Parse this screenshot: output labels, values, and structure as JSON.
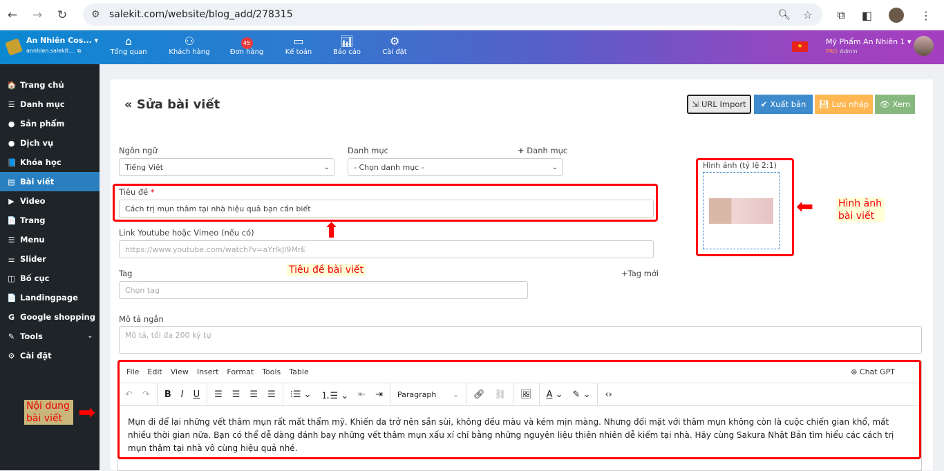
{
  "browser": {
    "url": "salekit.com/website/blog_add/278315"
  },
  "topnav": {
    "brand_name": "An Nhiên Cos...",
    "brand_domain": "annhien.salekit....",
    "items": [
      {
        "label": "Tổng quan",
        "icon": "home-icon"
      },
      {
        "label": "Khách hàng",
        "icon": "users-icon"
      },
      {
        "label": "Đơn hàng",
        "icon": "orders-icon",
        "badge": "45"
      },
      {
        "label": "Kế toán",
        "icon": "card-icon"
      },
      {
        "label": "Báo cáo",
        "icon": "chart-icon"
      },
      {
        "label": "Cài đặt",
        "icon": "gear-icon"
      }
    ],
    "user_name": "Mỹ Phẩm An Nhiên 1",
    "user_tier": "PRO",
    "user_role": "Admin"
  },
  "sidebar": {
    "items": [
      {
        "label": "Trang chủ",
        "icon": "🏠"
      },
      {
        "label": "Danh mục",
        "icon": "☰"
      },
      {
        "label": "Sản phẩm",
        "icon": "●"
      },
      {
        "label": "Dịch vụ",
        "icon": "●"
      },
      {
        "label": "Khóa học",
        "icon": "📘"
      },
      {
        "label": "Bài viết",
        "icon": "▤"
      },
      {
        "label": "Video",
        "icon": "▶"
      },
      {
        "label": "Trang",
        "icon": "📄"
      },
      {
        "label": "Menu",
        "icon": "☰"
      },
      {
        "label": "Slider",
        "icon": "⚌"
      },
      {
        "label": "Bố cục",
        "icon": "◫"
      },
      {
        "label": "Landingpage",
        "icon": "📄"
      },
      {
        "label": "Google shopping",
        "icon": "G"
      },
      {
        "label": "Tools",
        "icon": "✎"
      },
      {
        "label": "Cài đặt",
        "icon": "⚙"
      }
    ],
    "active": "Bài viết"
  },
  "page": {
    "title": "Sửa bài viết",
    "buttons": {
      "url_import": "URL Import",
      "publish": "Xuất bản",
      "draft": "Lưu nháp",
      "view": "Xem"
    },
    "language_label": "Ngôn ngữ",
    "language_value": "Tiếng Việt",
    "category_label": "Danh mục",
    "category_value": "- Chọn danh mục -",
    "add_category": "Danh mục",
    "title_label": "Tiêu đề",
    "required_mark": "*",
    "title_value": "Cách trị mụn thâm tại nhà hiệu quả bạn cần biết",
    "video_label": "Link Youtube hoặc Vimeo (nếu có)",
    "video_placeholder": "https://www.youtube.com/watch?v=aYrIkJl9MrE",
    "tag_label": "Tag",
    "new_tag": "+Tag mới",
    "tag_placeholder": "Chọn tag",
    "desc_label": "Mô tả ngắn",
    "desc_placeholder": "Mô tả, tối đa 200 ký tự",
    "image_label": "Hình ảnh (tỷ lệ 2:1)"
  },
  "editor": {
    "menu": [
      "File",
      "Edit",
      "View",
      "Insert",
      "Format",
      "Tools",
      "Table"
    ],
    "chatgpt": "Chat GPT",
    "block_format": "Paragraph",
    "content": "Mụn đi để lại những vết thâm mụn rất mất thẩm mỹ. Khiến da trở nên sần sùi, không đều màu và kém mịn màng. Nhưng đối mặt với thâm mụn không còn là cuộc chiến gian khổ, mất nhiều thời gian nữa. Bạn có thể dễ dàng đánh bay những vết thâm mụn xấu xí chỉ bằng những nguyên liệu thiên nhiên dễ kiếm tại nhà. Hãy cùng Sakura Nhật Bản tìm hiểu các cách trị mụn thâm tại nhà vô cùng hiệu quả nhé."
  },
  "annotations": {
    "title_note": "Tiêu đề bài viết",
    "image_note": "Hình ảnh bài viết",
    "content_note": "Nội dung bài viết"
  },
  "colors": {
    "annotation": "#ff0000",
    "active": "#2a7fc1",
    "publish": "#3d8bcd",
    "draft": "#ffb752",
    "view": "#87b87f"
  }
}
